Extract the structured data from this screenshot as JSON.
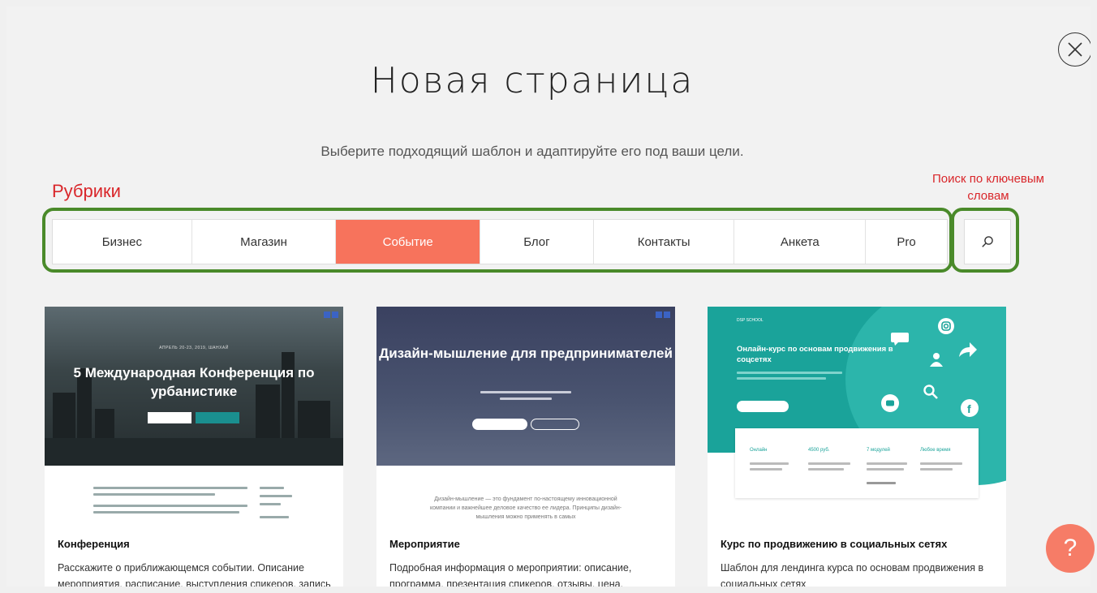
{
  "header": {
    "title": "Новая страница",
    "subtitle": "Выберите подходящий шаблон и адаптируйте его под ваши цели."
  },
  "annotations": {
    "categories_label": "Рубрики",
    "search_label": "Поиск по ключевым словам"
  },
  "tabs": [
    {
      "label": "Бизнес",
      "active": false
    },
    {
      "label": "Магазин",
      "active": false
    },
    {
      "label": "Событие",
      "active": true
    },
    {
      "label": "Блог",
      "active": false
    },
    {
      "label": "Контакты",
      "active": false
    },
    {
      "label": "Анкета",
      "active": false
    },
    {
      "label": "Pro",
      "active": false
    }
  ],
  "cards": [
    {
      "title": "Конференция",
      "description": "Расскажите о приближающемся событии. Описание мероприятия, расписание, выступления спикеров, запись на мероприятие.",
      "thumb": {
        "kicker": "АПРЕЛЬ 20-23, 2019, ШАНХАЙ",
        "heading": "5 Международная Конференция по урбанистике"
      }
    },
    {
      "title": "Мероприятие",
      "description": "Подробная информация о мероприятии: описание, программа, презентация спикеров, отзывы, цена, регистрация и контакты.",
      "thumb": {
        "heading": "Дизайн-мышление для предпринимателей",
        "body": "Дизайн-мышление — это фундамент по-настоящему инновационной компании и важнейшее деловое качество ее лидера. Принципы дизайн-мышления можно применять в самых"
      }
    },
    {
      "title": "Курс по продвижению в социальных сетях",
      "description": "Шаблон для лендинга курса по основам продвижения в социальных сетях",
      "thumb": {
        "school": "DSP SCHOOL",
        "heading": "Онлайн-курс по основам продвижения в соцсетях",
        "stats": [
          "Онлайн",
          "4500 руб.",
          "7 модулей",
          "Любое время"
        ]
      }
    }
  ],
  "help": {
    "label": "?"
  },
  "colors": {
    "accent": "#f7735c",
    "annotation": "#d9262a",
    "highlight_box": "#4a8a2a"
  },
  "icons": {
    "close": "close-icon",
    "search": "search-icon",
    "help": "help-icon"
  }
}
